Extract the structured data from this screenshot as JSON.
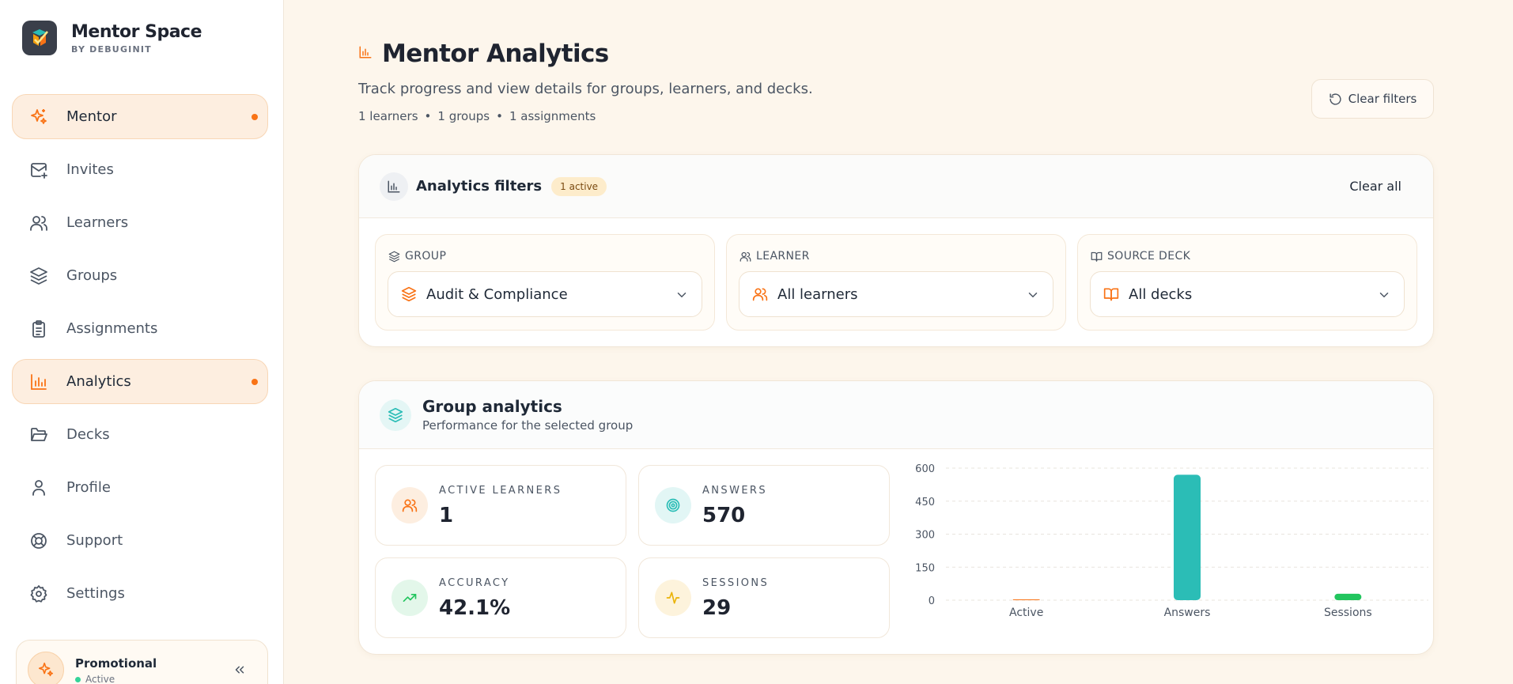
{
  "sidebar": {
    "brand_title": "Mentor Space",
    "brand_sub": "BY DEBUGINIT",
    "items": [
      {
        "label": "Mentor"
      },
      {
        "label": "Invites"
      },
      {
        "label": "Learners"
      },
      {
        "label": "Groups"
      },
      {
        "label": "Assignments"
      },
      {
        "label": "Analytics"
      },
      {
        "label": "Decks"
      },
      {
        "label": "Profile"
      },
      {
        "label": "Support"
      },
      {
        "label": "Settings"
      }
    ],
    "promo": {
      "name": "Promotional",
      "status": "Active"
    }
  },
  "header": {
    "title": "Mentor Analytics",
    "description": "Track progress and view details for groups, learners, and decks.",
    "meta_learners": "1 learners",
    "meta_groups": "1 groups",
    "meta_assignments": "1 assignments",
    "meta_separator": "•",
    "clear_filters": "Clear filters"
  },
  "filters": {
    "title": "Analytics filters",
    "badge": "1 active",
    "clear_all": "Clear all",
    "group": {
      "label": "GROUP",
      "value": "Audit & Compliance"
    },
    "learner": {
      "label": "LEARNER",
      "value": "All learners"
    },
    "deck": {
      "label": "SOURCE DECK",
      "value": "All decks"
    }
  },
  "group_analytics": {
    "title": "Group analytics",
    "subtitle": "Performance for the selected group",
    "stats": {
      "active_learners": {
        "label": "ACTIVE LEARNERS",
        "value": "1"
      },
      "answers": {
        "label": "ANSWERS",
        "value": "570"
      },
      "accuracy": {
        "label": "ACCURACY",
        "value": "42.1%"
      },
      "sessions": {
        "label": "SESSIONS",
        "value": "29"
      }
    }
  },
  "colors": {
    "accent": "#f97316",
    "teal": "#2bbdb6",
    "green": "#22c55e",
    "active_bg": "#fdeee0"
  },
  "chart_data": {
    "type": "bar",
    "categories": [
      "Active",
      "Answers",
      "Sessions"
    ],
    "values": [
      1,
      570,
      29
    ],
    "colors": [
      "#f97316",
      "#2bbdb6",
      "#22c55e"
    ],
    "yticks": [
      0,
      150,
      300,
      450,
      600
    ],
    "ylim": [
      0,
      600
    ],
    "grid": true
  }
}
